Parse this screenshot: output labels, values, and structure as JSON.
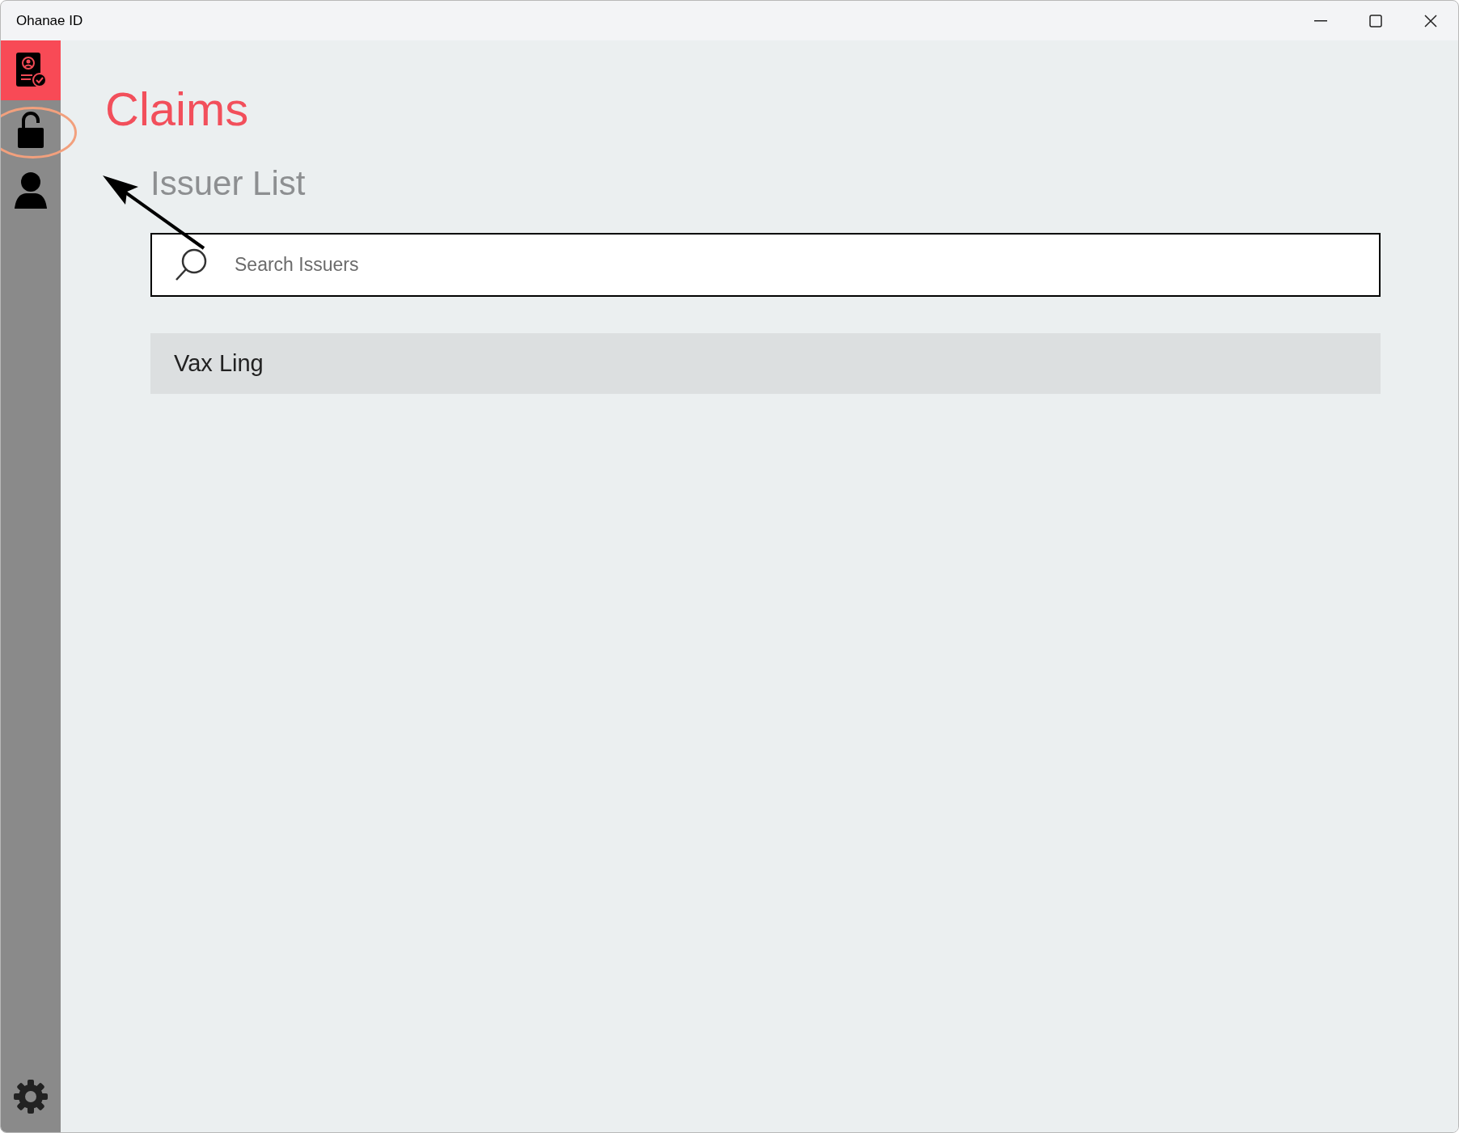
{
  "window": {
    "title": "Ohanae ID"
  },
  "sidebar": {
    "items": [
      {
        "kind": "claims",
        "selected": true
      },
      {
        "kind": "lock",
        "selected": false
      },
      {
        "kind": "person",
        "selected": false
      }
    ]
  },
  "page": {
    "title": "Claims",
    "section_title": "Issuer List"
  },
  "search": {
    "placeholder": "Search Issuers"
  },
  "issuers": [
    {
      "name": "Vax Ling"
    }
  ]
}
